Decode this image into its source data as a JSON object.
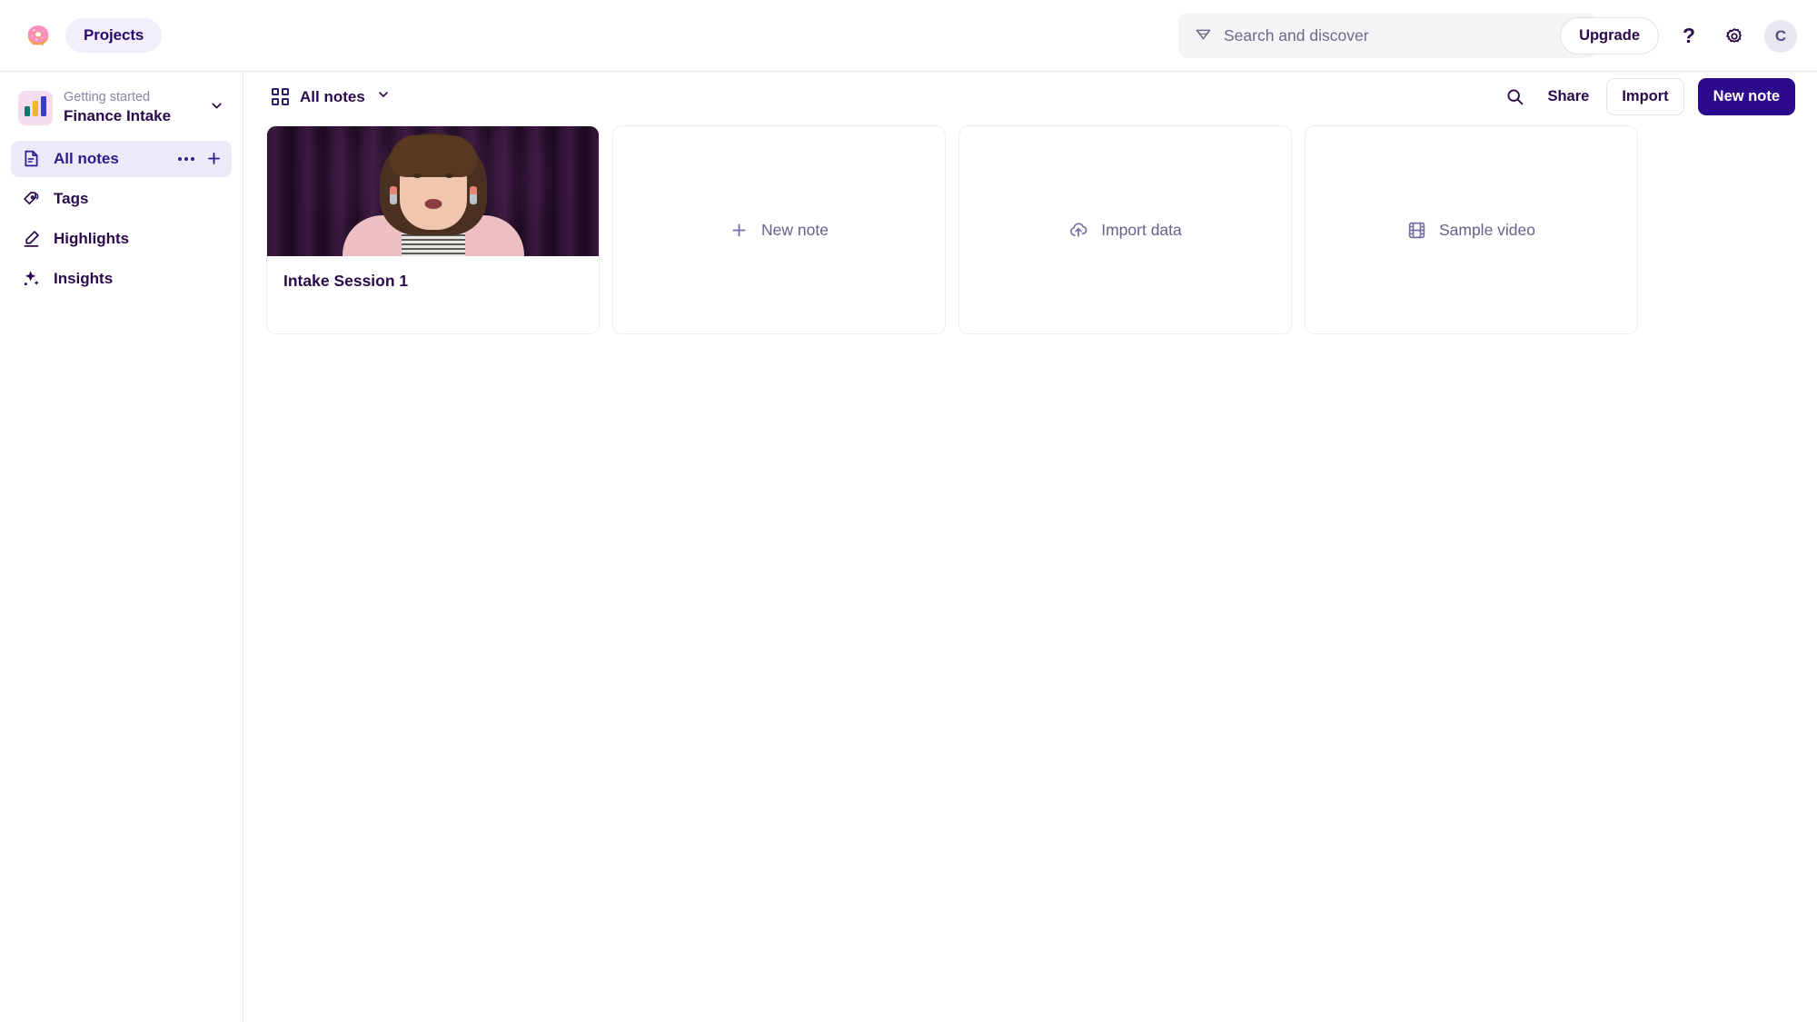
{
  "header": {
    "logo_icon": "donut-icon",
    "projects_label": "Projects",
    "search": {
      "icon": "gem-search-icon",
      "placeholder": "Search and discover",
      "value": ""
    },
    "upgrade_label": "Upgrade",
    "help_icon": "question-mark-icon",
    "settings_icon": "gear-icon",
    "avatar_initial": "C"
  },
  "sidebar": {
    "project": {
      "eyebrow": "Getting started",
      "name": "Finance Intake",
      "icon": "bar-chart-icon",
      "chevron_icon": "chevron-down-icon"
    },
    "items": [
      {
        "label": "All notes",
        "icon": "document-icon",
        "active": true
      },
      {
        "label": "Tags",
        "icon": "tag-icon",
        "active": false
      },
      {
        "label": "Highlights",
        "icon": "highlighter-icon",
        "active": false
      },
      {
        "label": "Insights",
        "icon": "sparkles-icon",
        "active": false
      }
    ],
    "all_notes_actions": {
      "more_icon": "ellipsis-icon",
      "add_icon": "plus-icon"
    }
  },
  "toolbar": {
    "view_icon": "grid-view-icon",
    "view_label": "All notes",
    "view_chevron_icon": "chevron-down-icon",
    "search_icon": "magnifier-icon",
    "share_label": "Share",
    "import_label": "Import",
    "new_note_label": "New note"
  },
  "cards": {
    "note": {
      "title": "Intake Session 1",
      "thumbnail": "video-thumbnail-woman-purple-curtain"
    },
    "actions": [
      {
        "label": "New note",
        "icon": "plus-icon"
      },
      {
        "label": "Import data",
        "icon": "cloud-upload-icon"
      },
      {
        "label": "Sample video",
        "icon": "film-strip-icon"
      }
    ]
  },
  "colors": {
    "accent": "#2d0a8c",
    "text": "#2a0a4a",
    "muted": "#6a608a",
    "active_bg": "#ece9f8",
    "border": "#ebe9ef"
  }
}
